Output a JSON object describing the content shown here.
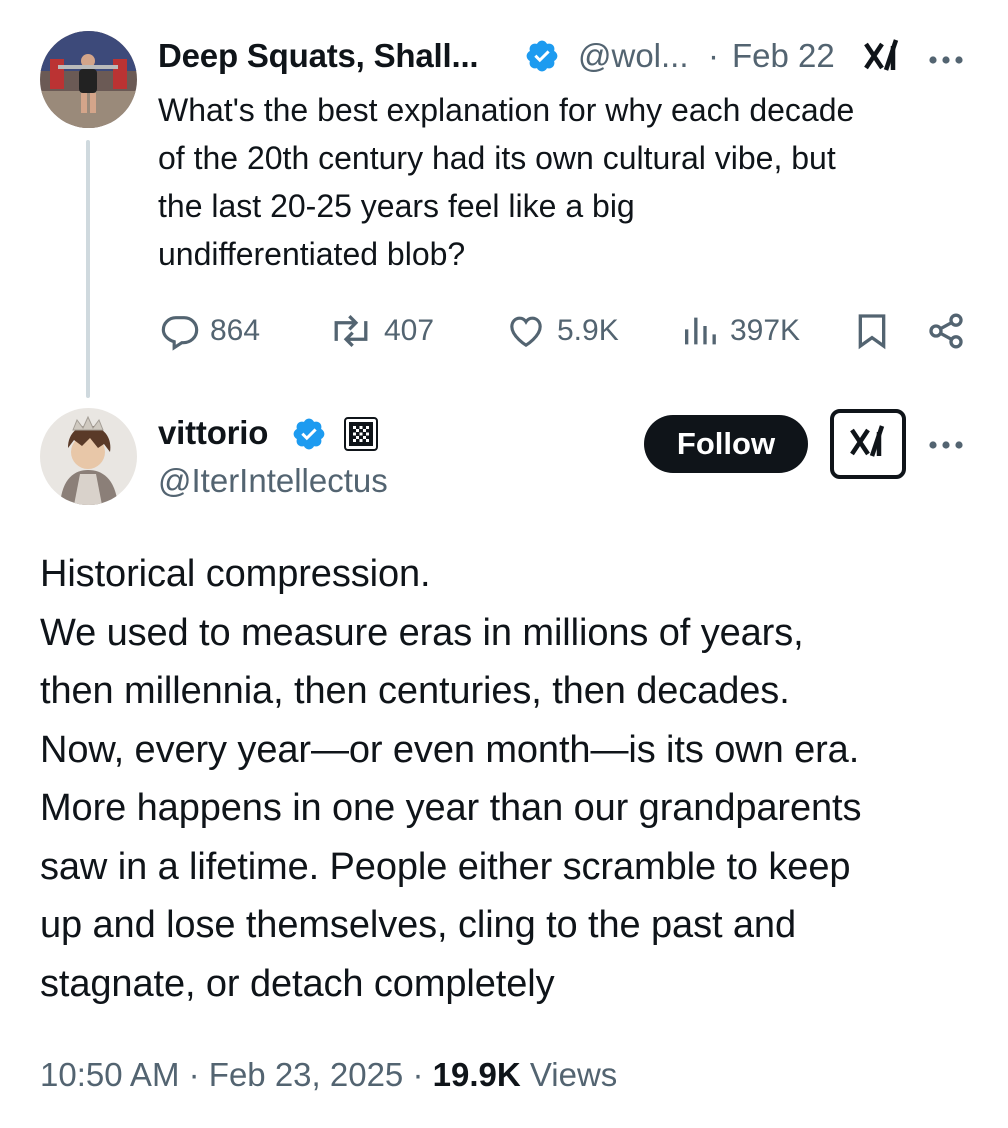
{
  "parent_tweet": {
    "display_name": "Deep Squats, Shall...",
    "handle": "@wol...",
    "separator": "·",
    "date": "Feb 22",
    "text": "What's the best explanation for why each decade of the 20th century had its own cultural vibe, but the last 20-25 years feel like a big undifferentiated blob?",
    "text_lines": [
      "What's the best explanation for why each decade",
      "of the 20th century had its own cultural vibe, but",
      "the last 20-25 years feel like a big",
      "undifferentiated blob?"
    ],
    "replies": "864",
    "reposts": "407",
    "likes": "5.9K",
    "views": "397K"
  },
  "main_tweet": {
    "display_name": "vittorio",
    "handle": "@IterIntellectus",
    "follow_label": "Follow",
    "text_lines": [
      "Historical compression.",
      "We used to measure eras in millions of years,",
      "then millennia, then centuries, then decades.",
      "Now, every year—or even month—is its own era.",
      "More happens in one year than our grandparents",
      "saw in a lifetime. People either scramble to keep",
      "up and lose themselves, cling to the past and",
      "stagnate, or detach completely"
    ],
    "time": "10:50 AM",
    "separator": "·",
    "date": "Feb 23, 2025",
    "views_count": "19.9K",
    "views_label": "Views"
  },
  "colors": {
    "text": "#0f1419",
    "secondary": "#536471",
    "verified": "#1d9bf0",
    "thread_line": "#cfd9de"
  },
  "icons": {
    "verified": "verified-badge-icon",
    "grok": "grok-icon",
    "more": "more-dots-icon",
    "reply": "reply-icon",
    "repost": "repost-icon",
    "like": "heart-icon",
    "views": "views-bar-icon",
    "bookmark": "bookmark-icon",
    "share": "share-icon",
    "affiliate": "affiliate-badge-icon"
  }
}
